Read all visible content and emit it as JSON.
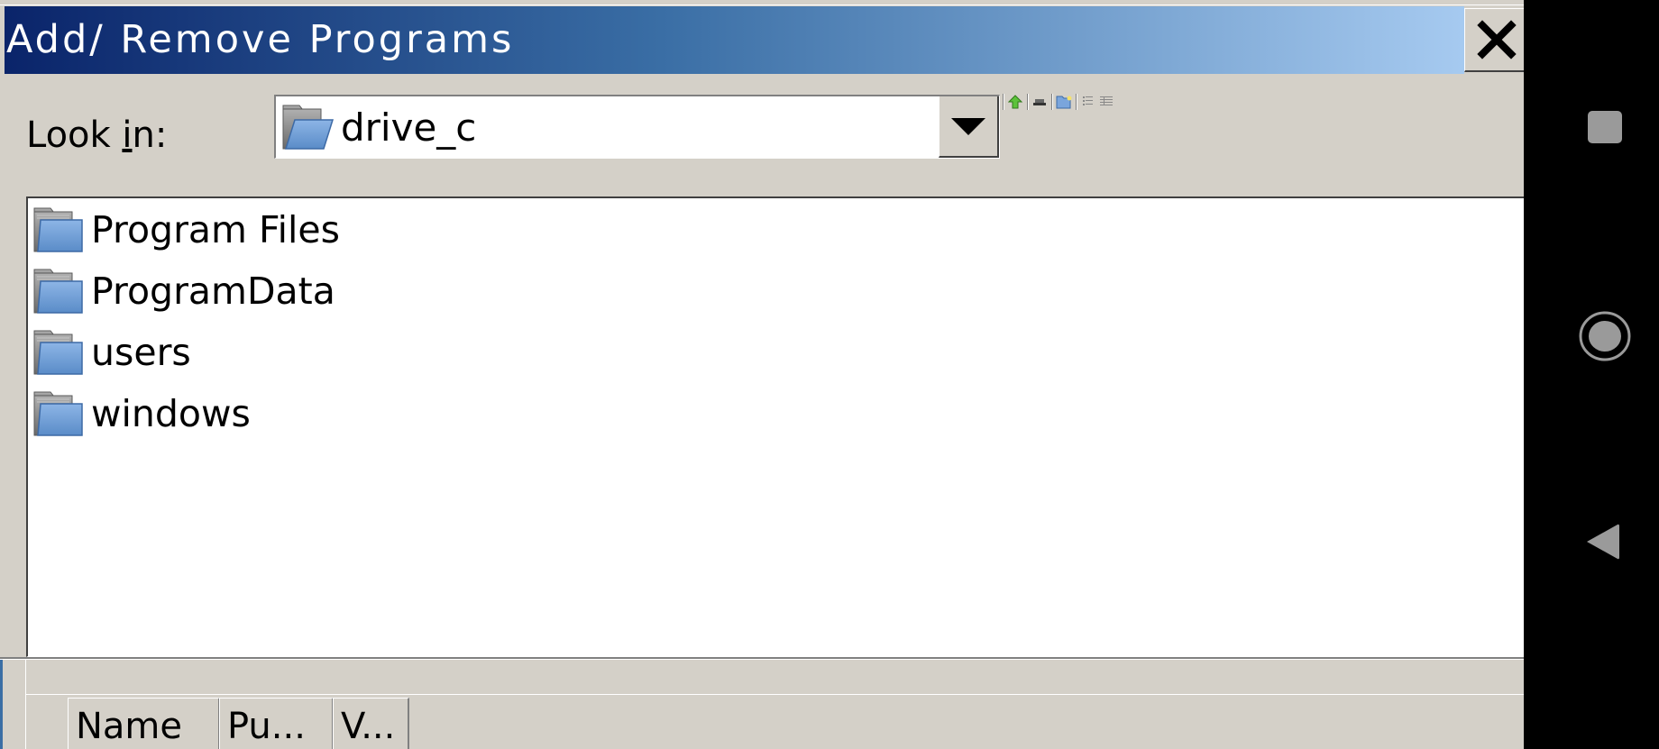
{
  "window": {
    "title": "Add/ Remove Programs",
    "close_icon": "close-x-icon"
  },
  "look_in": {
    "label_before": "Look ",
    "label_mnemonic": "i",
    "label_after": "n:",
    "selected_value": "drive_c",
    "selected_icon": "folder-icon",
    "dropdown_icon": "triangle-down-icon"
  },
  "toolbar": {
    "buttons": [
      {
        "name": "up-one-level",
        "icon": "up-arrow-icon"
      },
      {
        "name": "desktop",
        "icon": "desktop-icon"
      },
      {
        "name": "create-new-folder",
        "icon": "new-folder-icon"
      },
      {
        "name": "list-view",
        "icon": "list-view-icon"
      },
      {
        "name": "details-view",
        "icon": "details-view-icon"
      }
    ]
  },
  "file_list": {
    "items": [
      {
        "name": "Program Files",
        "icon": "folder-icon"
      },
      {
        "name": "ProgramData",
        "icon": "folder-icon"
      },
      {
        "name": "users",
        "icon": "folder-icon"
      },
      {
        "name": "windows",
        "icon": "folder-icon"
      }
    ]
  },
  "programs_table": {
    "columns": [
      "Name",
      "Pu...",
      "V..."
    ]
  },
  "android_nav": {
    "buttons": [
      {
        "name": "recents",
        "icon": "square-icon"
      },
      {
        "name": "home",
        "icon": "circle-icon"
      },
      {
        "name": "back",
        "icon": "back-triangle-icon"
      }
    ]
  },
  "colors": {
    "title_gradient_start": "#0a246a",
    "title_gradient_end": "#a6caf0",
    "dialog_bg": "#d4d0c8",
    "folder_blue": "#6e9fd8",
    "nav_icon_gray": "#9a9a9a"
  }
}
